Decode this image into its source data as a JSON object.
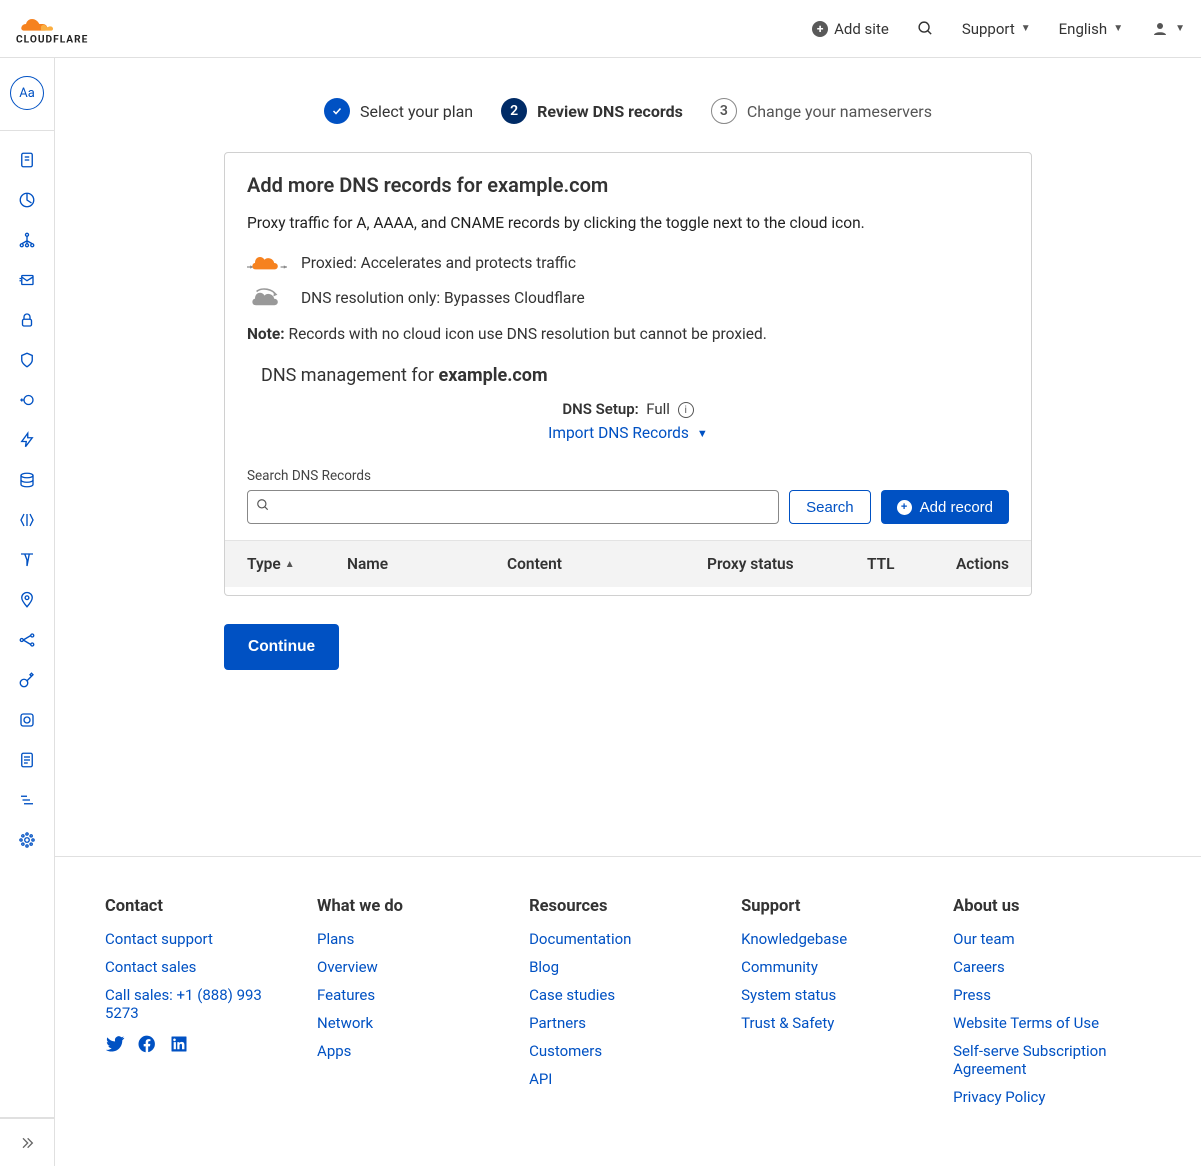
{
  "header": {
    "add_site": "Add site",
    "support": "Support",
    "language": "English"
  },
  "sidebar": {
    "avatar": "Aa"
  },
  "stepper": {
    "step1": "Select your plan",
    "step2": "Review DNS records",
    "step3": "Change your nameservers",
    "step2_num": "2",
    "step3_num": "3"
  },
  "panel": {
    "title": "Add more DNS records for example.com",
    "lead": "Proxy traffic for A, AAAA, and CNAME records by clicking the toggle next to the cloud icon.",
    "proxied": "Proxied: Accelerates and protects traffic",
    "dns_only": "DNS resolution only: Bypasses Cloudflare",
    "note_label": "Note:",
    "note_text": " Records with no cloud icon use DNS resolution but cannot be proxied.",
    "dns_mgmt_prefix": "DNS management for ",
    "dns_mgmt_domain": "example.com",
    "dns_setup_label": "DNS Setup:",
    "dns_setup_value": "Full",
    "import_link": "Import DNS Records",
    "search_label": "Search DNS Records",
    "search_btn": "Search",
    "add_record_btn": "Add record",
    "columns": {
      "type": "Type",
      "name": "Name",
      "content": "Content",
      "proxy": "Proxy status",
      "ttl": "TTL",
      "actions": "Actions"
    }
  },
  "continue_btn": "Continue",
  "footer": {
    "contact": {
      "title": "Contact",
      "links": [
        "Contact support",
        "Contact sales",
        "Call sales: +1 (888) 993 5273"
      ]
    },
    "what_we_do": {
      "title": "What we do",
      "links": [
        "Plans",
        "Overview",
        "Features",
        "Network",
        "Apps"
      ]
    },
    "resources": {
      "title": "Resources",
      "links": [
        "Documentation",
        "Blog",
        "Case studies",
        "Partners",
        "Customers",
        "API"
      ]
    },
    "support": {
      "title": "Support",
      "links": [
        "Knowledgebase",
        "Community",
        "System status",
        "Trust & Safety"
      ]
    },
    "about": {
      "title": "About us",
      "links": [
        "Our team",
        "Careers",
        "Press",
        "Website Terms of Use",
        "Self-serve Subscription Agreement",
        "Privacy Policy"
      ]
    }
  }
}
